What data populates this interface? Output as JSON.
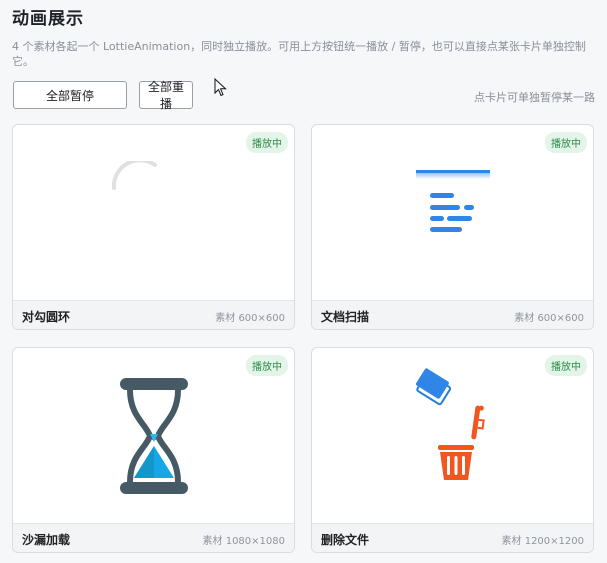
{
  "page": {
    "title": "动画展示",
    "description": "4 个素材各起一个 LottieAnimation，同时独立播放。可用上方按钮统一播放 / 暂停，也可以直接点某张卡片单独控制它。"
  },
  "toolbar": {
    "pause_all_label": "全部暂停",
    "replay_all_label": "全部重播",
    "hint": "点卡片可单独暂停某一路"
  },
  "cards": [
    {
      "name": "对勾圆环",
      "status": "播放中",
      "meta": "素材 600×600",
      "icon": "checkmark-ring-spinner"
    },
    {
      "name": "文档扫描",
      "status": "播放中",
      "meta": "素材 600×600",
      "icon": "document-scan"
    },
    {
      "name": "沙漏加载",
      "status": "播放中",
      "meta": "素材 1080×1080",
      "icon": "hourglass"
    },
    {
      "name": "删除文件",
      "status": "播放中",
      "meta": "素材 1200×1200",
      "icon": "delete-file-trash"
    }
  ],
  "colors": {
    "status_bg": "#e3f4e8",
    "status_text": "#2e8a4a",
    "scan_blue": "#2f86e6",
    "hourglass_frame": "#455a64",
    "hourglass_sand": "#16a8e6",
    "trash_orange": "#f0561d"
  }
}
